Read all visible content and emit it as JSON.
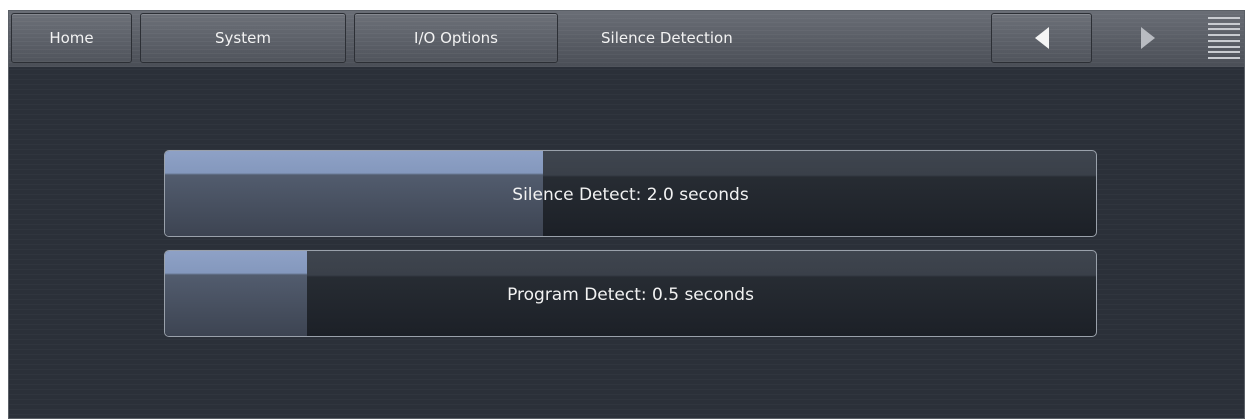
{
  "nav": {
    "home_label": "Home",
    "system_label": "System",
    "io_options_label": "I/O Options",
    "current_page": "Silence Detection"
  },
  "controls": [
    {
      "label": "Silence Detect: 2.0 seconds",
      "level": 0.406
    },
    {
      "label": "Program Detect: 0.5 seconds",
      "level": 0.153
    }
  ],
  "icons": {
    "back": "arrow-left-icon",
    "forward": "arrow-right-icon",
    "menu": "menu-icon"
  },
  "colors": {
    "background": "#2b3039",
    "slider_fill": "#8ea1c6",
    "text": "#f2f2f2"
  }
}
